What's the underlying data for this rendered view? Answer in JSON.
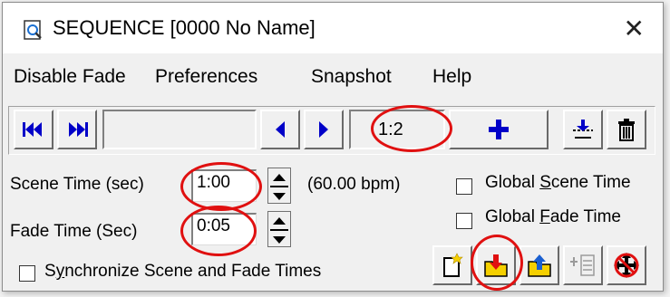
{
  "window": {
    "title": "SEQUENCE [0000 No Name]",
    "close_glyph": "✕"
  },
  "menu": {
    "items": [
      "Disable Fade",
      "Preferences",
      "Snapshot",
      "Help"
    ]
  },
  "transport": {
    "counter": "1:2",
    "icons": {
      "rewind": "rewind-icon",
      "fast_forward": "fast-forward-icon",
      "prev": "previous-icon",
      "next": "next-icon",
      "add": "add-icon",
      "insert": "insert-icon",
      "delete": "trash-icon"
    }
  },
  "scene_time": {
    "label": "Scene Time (sec)",
    "value": "1:00",
    "bpm": "(60.00 bpm)"
  },
  "fade_time": {
    "label": "Fade Time (Sec)",
    "value": "0:05"
  },
  "global_scene": {
    "label_pre": "Global ",
    "label_accel": "S",
    "label_post": "cene Time",
    "checked": false
  },
  "global_fade": {
    "label_pre": "Global ",
    "label_accel": "F",
    "label_post": "ade Time",
    "checked": false
  },
  "sync": {
    "label_pre": "S",
    "label_accel": "y",
    "label_post": "nchronize Scene and Fade Times",
    "checked": false
  },
  "bottom_tools": {
    "icons": [
      "new-scene-icon",
      "load-scene-icon",
      "save-scene-icon",
      "merge-icon",
      "no-move-icon"
    ]
  },
  "colors": {
    "accent_blue": "#0000c8",
    "annotation_red": "#e01010",
    "folder_yellow": "#f5d000"
  }
}
